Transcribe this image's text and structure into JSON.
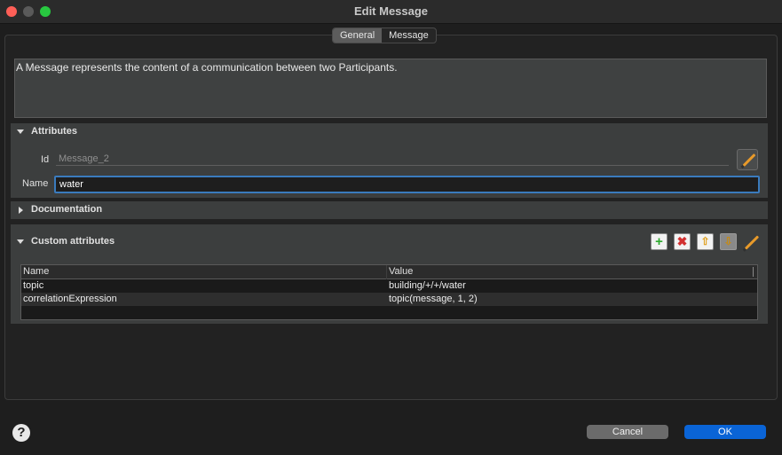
{
  "window": {
    "title": "Edit Message"
  },
  "tabs": [
    {
      "label": "General",
      "active": true
    },
    {
      "label": "Message",
      "active": false
    }
  ],
  "description": "A Message represents the content of a communication between two Participants.",
  "sections": {
    "attributes": {
      "label": "Attributes",
      "expanded": true,
      "id_label": "Id",
      "id_value": "Message_2",
      "name_label": "Name",
      "name_value": "water"
    },
    "documentation": {
      "label": "Documentation",
      "expanded": false
    },
    "custom_attributes": {
      "label": "Custom attributes",
      "expanded": true,
      "toolbar": [
        "add-icon",
        "delete-icon",
        "move-up-icon",
        "move-down-icon",
        "edit-icon"
      ],
      "columns": [
        "Name",
        "Value"
      ],
      "rows": [
        {
          "name": "topic",
          "value": "building/+/+/water"
        },
        {
          "name": "correlationExpression",
          "value": "topic(message, 1, 2)"
        }
      ]
    }
  },
  "footer": {
    "help_icon": "help-icon",
    "cancel_label": "Cancel",
    "ok_label": "OK"
  },
  "colors": {
    "accent": "#0a64d6",
    "focus": "#3a7bbd",
    "add": "#2eaa2e",
    "delete": "#d23030",
    "arrow": "#e0a020",
    "pencil": "#e89a2a"
  }
}
